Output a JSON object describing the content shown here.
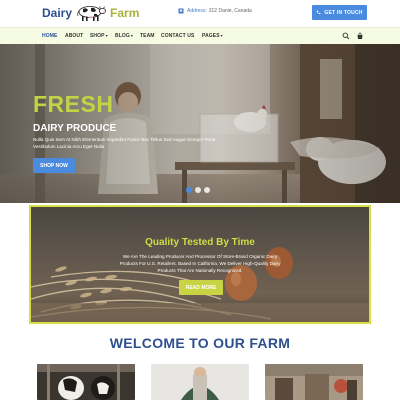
{
  "brand": {
    "logo_left": "Dairy",
    "logo_right": "Farm",
    "accent": "#2f4f8f",
    "accent_green": "#c2d444",
    "button_blue": "#4a8be0"
  },
  "header": {
    "address_label": "Address:",
    "address_value": "312 Danie, Canada",
    "cta_label": "GET IN TOUCH"
  },
  "nav": {
    "items": [
      {
        "label": "HOME",
        "active": true
      },
      {
        "label": "ABOUT"
      },
      {
        "label": "SHOP",
        "caret": "▾"
      },
      {
        "label": "BLOG",
        "caret": "▾"
      },
      {
        "label": "TEAM"
      },
      {
        "label": "CONTACT US"
      },
      {
        "label": "PAGES",
        "caret": "▾"
      }
    ],
    "icons": [
      "search-icon",
      "cart-icon"
    ]
  },
  "hero": {
    "title": "FRESH",
    "subtitle": "DAIRY PRODUCE",
    "text": "Nulla Quis Sem At Nibh Elementum Imperdiet Fusce Nec Tellus Sed Augue Semper Porta Vestibulum Lacinia Arcu Eget Nulla",
    "button_label": "SHOP NOW",
    "slides": 3,
    "active_slide": 1
  },
  "quality": {
    "title": "Quality Tested By Time",
    "text": "We Are The Leading Producer And Processor Of Store-Brand Organic Dairy Products For U.S. Retailers. Based In California, We Deliver High-Quality Dairy Products That Are Nationally Recognized.",
    "button_label": "READ MORE"
  },
  "welcome": {
    "title": "WELCOME TO OUR FARM"
  }
}
